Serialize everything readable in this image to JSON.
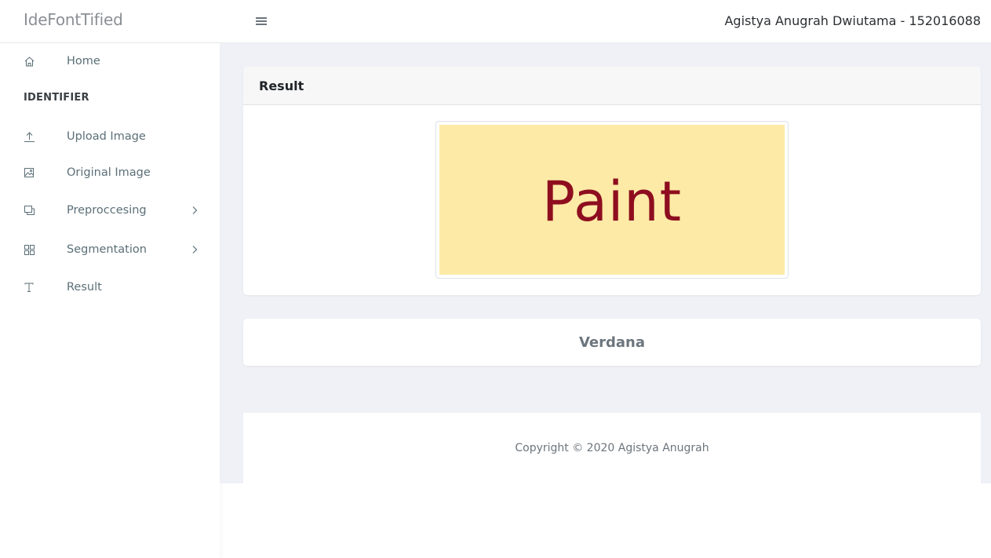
{
  "header": {
    "brand": "IdeFontTified",
    "menu_icon": "hamburger-icon",
    "user": "Agistya Anugrah Dwiutama - 152016088"
  },
  "sidebar": {
    "section_title": "IDENTIFIER",
    "items": [
      {
        "label": "Home",
        "icon": "home-icon"
      },
      {
        "label": "Upload Image",
        "icon": "upload-icon"
      },
      {
        "label": "Original Image",
        "icon": "image-icon"
      },
      {
        "label": "Preproccesing",
        "icon": "layers-icon",
        "has_submenu": true
      },
      {
        "label": "Segmentation",
        "icon": "grid-icon",
        "has_submenu": true
      },
      {
        "label": "Result",
        "icon": "text-icon"
      }
    ]
  },
  "main": {
    "result_card": {
      "title": "Result",
      "image_text": "Paint",
      "image_background": "#fceaa6",
      "image_text_color": "#8e0e1f"
    },
    "font_result": "Verdana"
  },
  "footer": {
    "copyright": "Copyright © 2020 Agistya Anugrah"
  }
}
